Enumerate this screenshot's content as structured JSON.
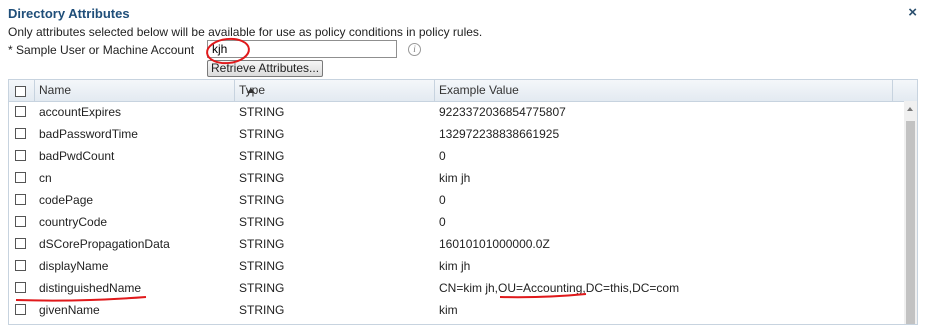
{
  "dialog": {
    "title": "Directory Attributes",
    "close_glyph": "×",
    "description": "Only attributes selected below will be available for use as policy conditions in policy rules.",
    "sample_label": "* Sample User or Machine Account",
    "sample_value": "kjh",
    "info_glyph": "i",
    "retrieve_label": "Retrieve Attributes..."
  },
  "table": {
    "columns": [
      "Name",
      "Type",
      "Example Value"
    ],
    "sort_column": "Name",
    "rows": [
      {
        "name": "accountExpires",
        "type": "STRING",
        "example": "9223372036854775807"
      },
      {
        "name": "badPasswordTime",
        "type": "STRING",
        "example": "132972238838661925"
      },
      {
        "name": "badPwdCount",
        "type": "STRING",
        "example": "0"
      },
      {
        "name": "cn",
        "type": "STRING",
        "example": "kim jh"
      },
      {
        "name": "codePage",
        "type": "STRING",
        "example": "0"
      },
      {
        "name": "countryCode",
        "type": "STRING",
        "example": "0"
      },
      {
        "name": "dSCorePropagationData",
        "type": "STRING",
        "example": "16010101000000.0Z"
      },
      {
        "name": "displayName",
        "type": "STRING",
        "example": "kim jh"
      },
      {
        "name": "distinguishedName",
        "type": "STRING",
        "example": "CN=kim jh,OU=Accounting,DC=this,DC=com"
      },
      {
        "name": "givenName",
        "type": "STRING",
        "example": "kim"
      }
    ]
  },
  "colors": {
    "title": "#1f4e79",
    "annotation": "#e0191b",
    "header_bg": "#e3eaf1"
  }
}
